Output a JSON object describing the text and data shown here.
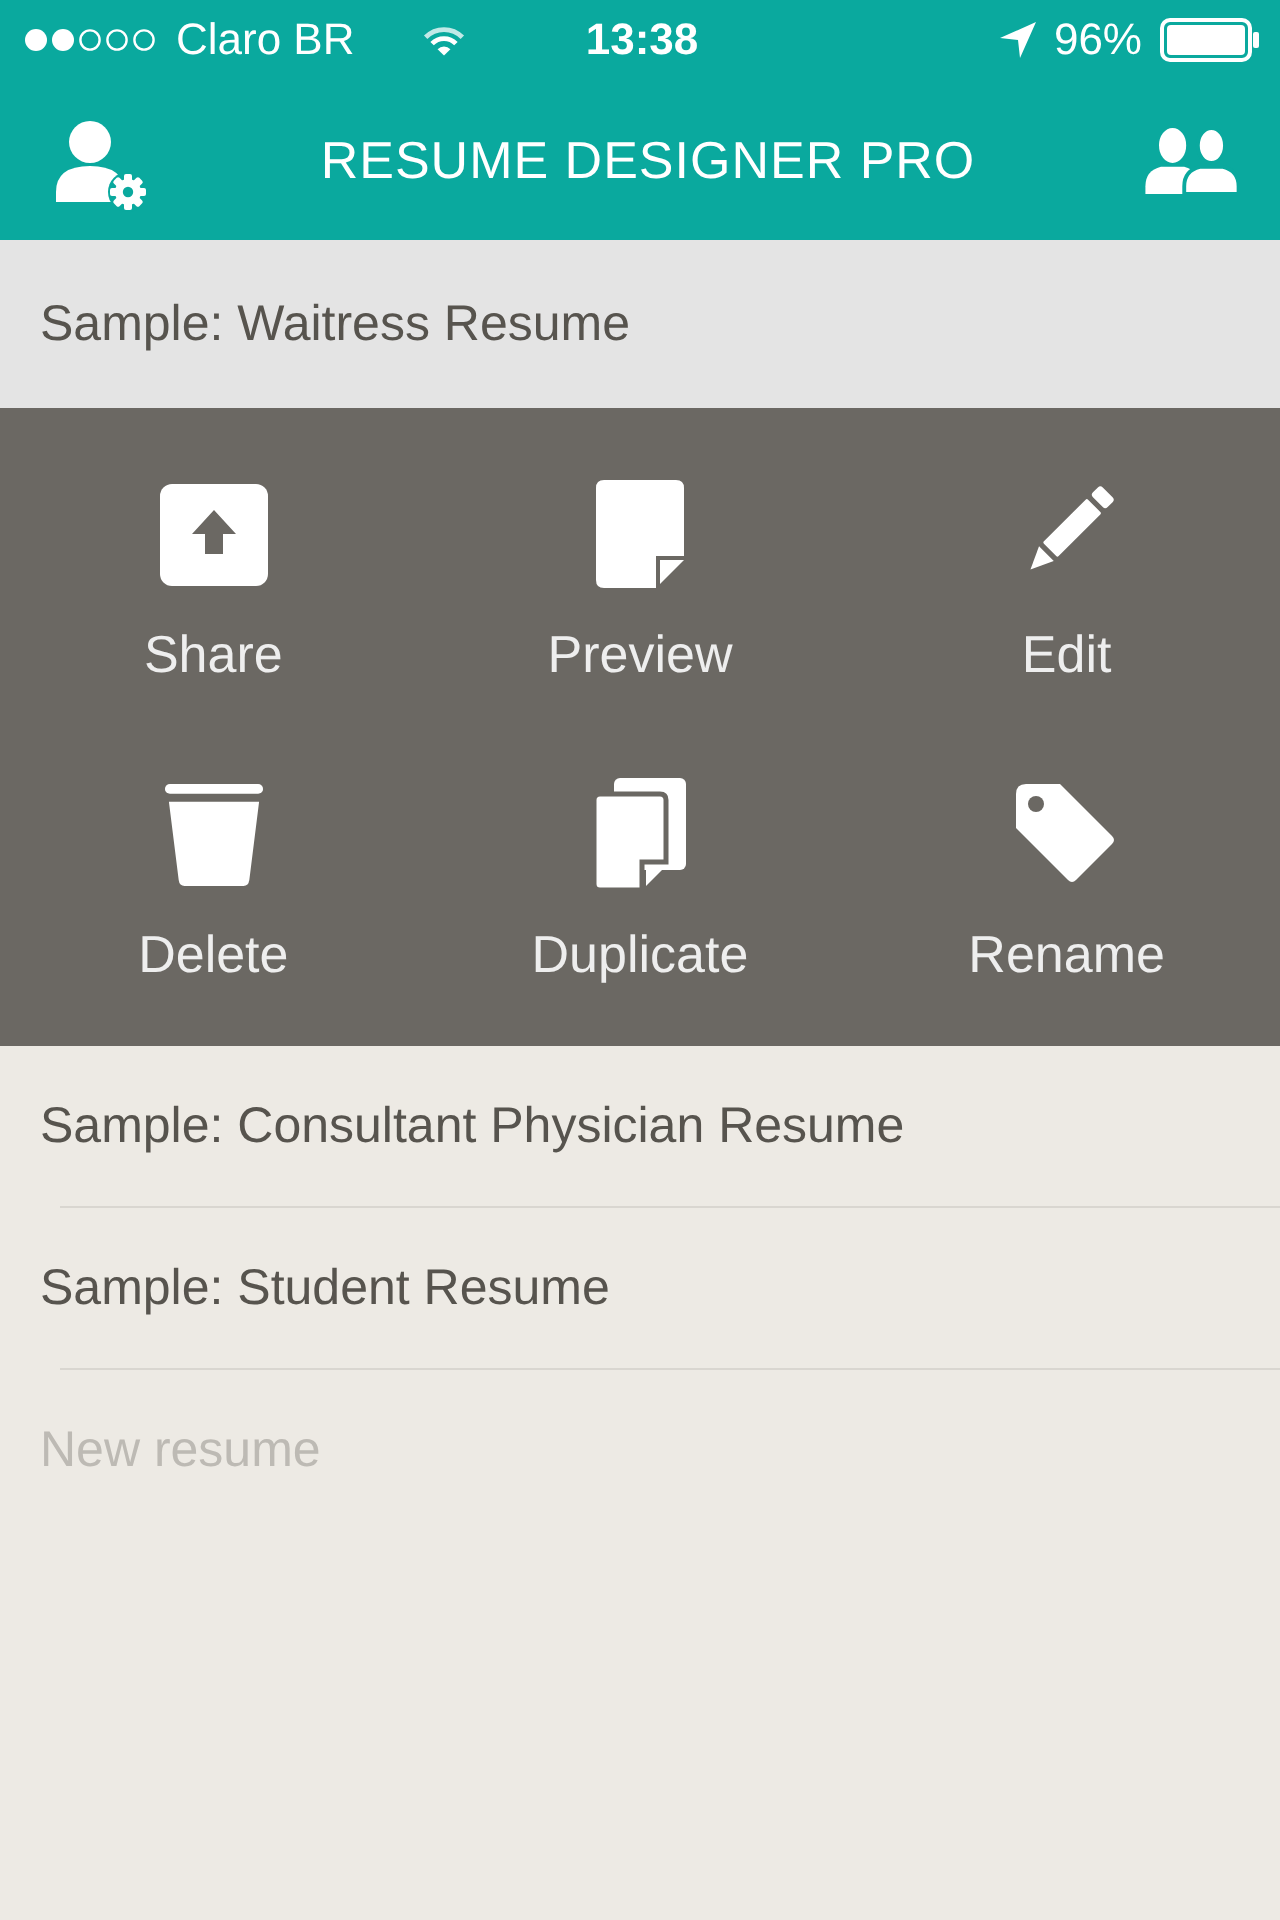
{
  "status_bar": {
    "carrier": "Claro BR",
    "time": "13:38",
    "battery": "96%"
  },
  "nav_bar": {
    "title": "RESUME DESIGNER PRO"
  },
  "resumes": [
    {
      "name": "Sample: Waitress Resume",
      "selected": true
    },
    {
      "name": "Sample: Consultant Physician Resume",
      "selected": false
    },
    {
      "name": "Sample: Student Resume",
      "selected": false
    }
  ],
  "actions": [
    {
      "kind": "share",
      "label": "Share"
    },
    {
      "kind": "preview",
      "label": "Preview"
    },
    {
      "kind": "edit",
      "label": "Edit"
    },
    {
      "kind": "delete",
      "label": "Delete"
    },
    {
      "kind": "duplicate",
      "label": "Duplicate"
    },
    {
      "kind": "rename",
      "label": "Rename"
    }
  ],
  "new_resume": {
    "placeholder": "New resume"
  }
}
